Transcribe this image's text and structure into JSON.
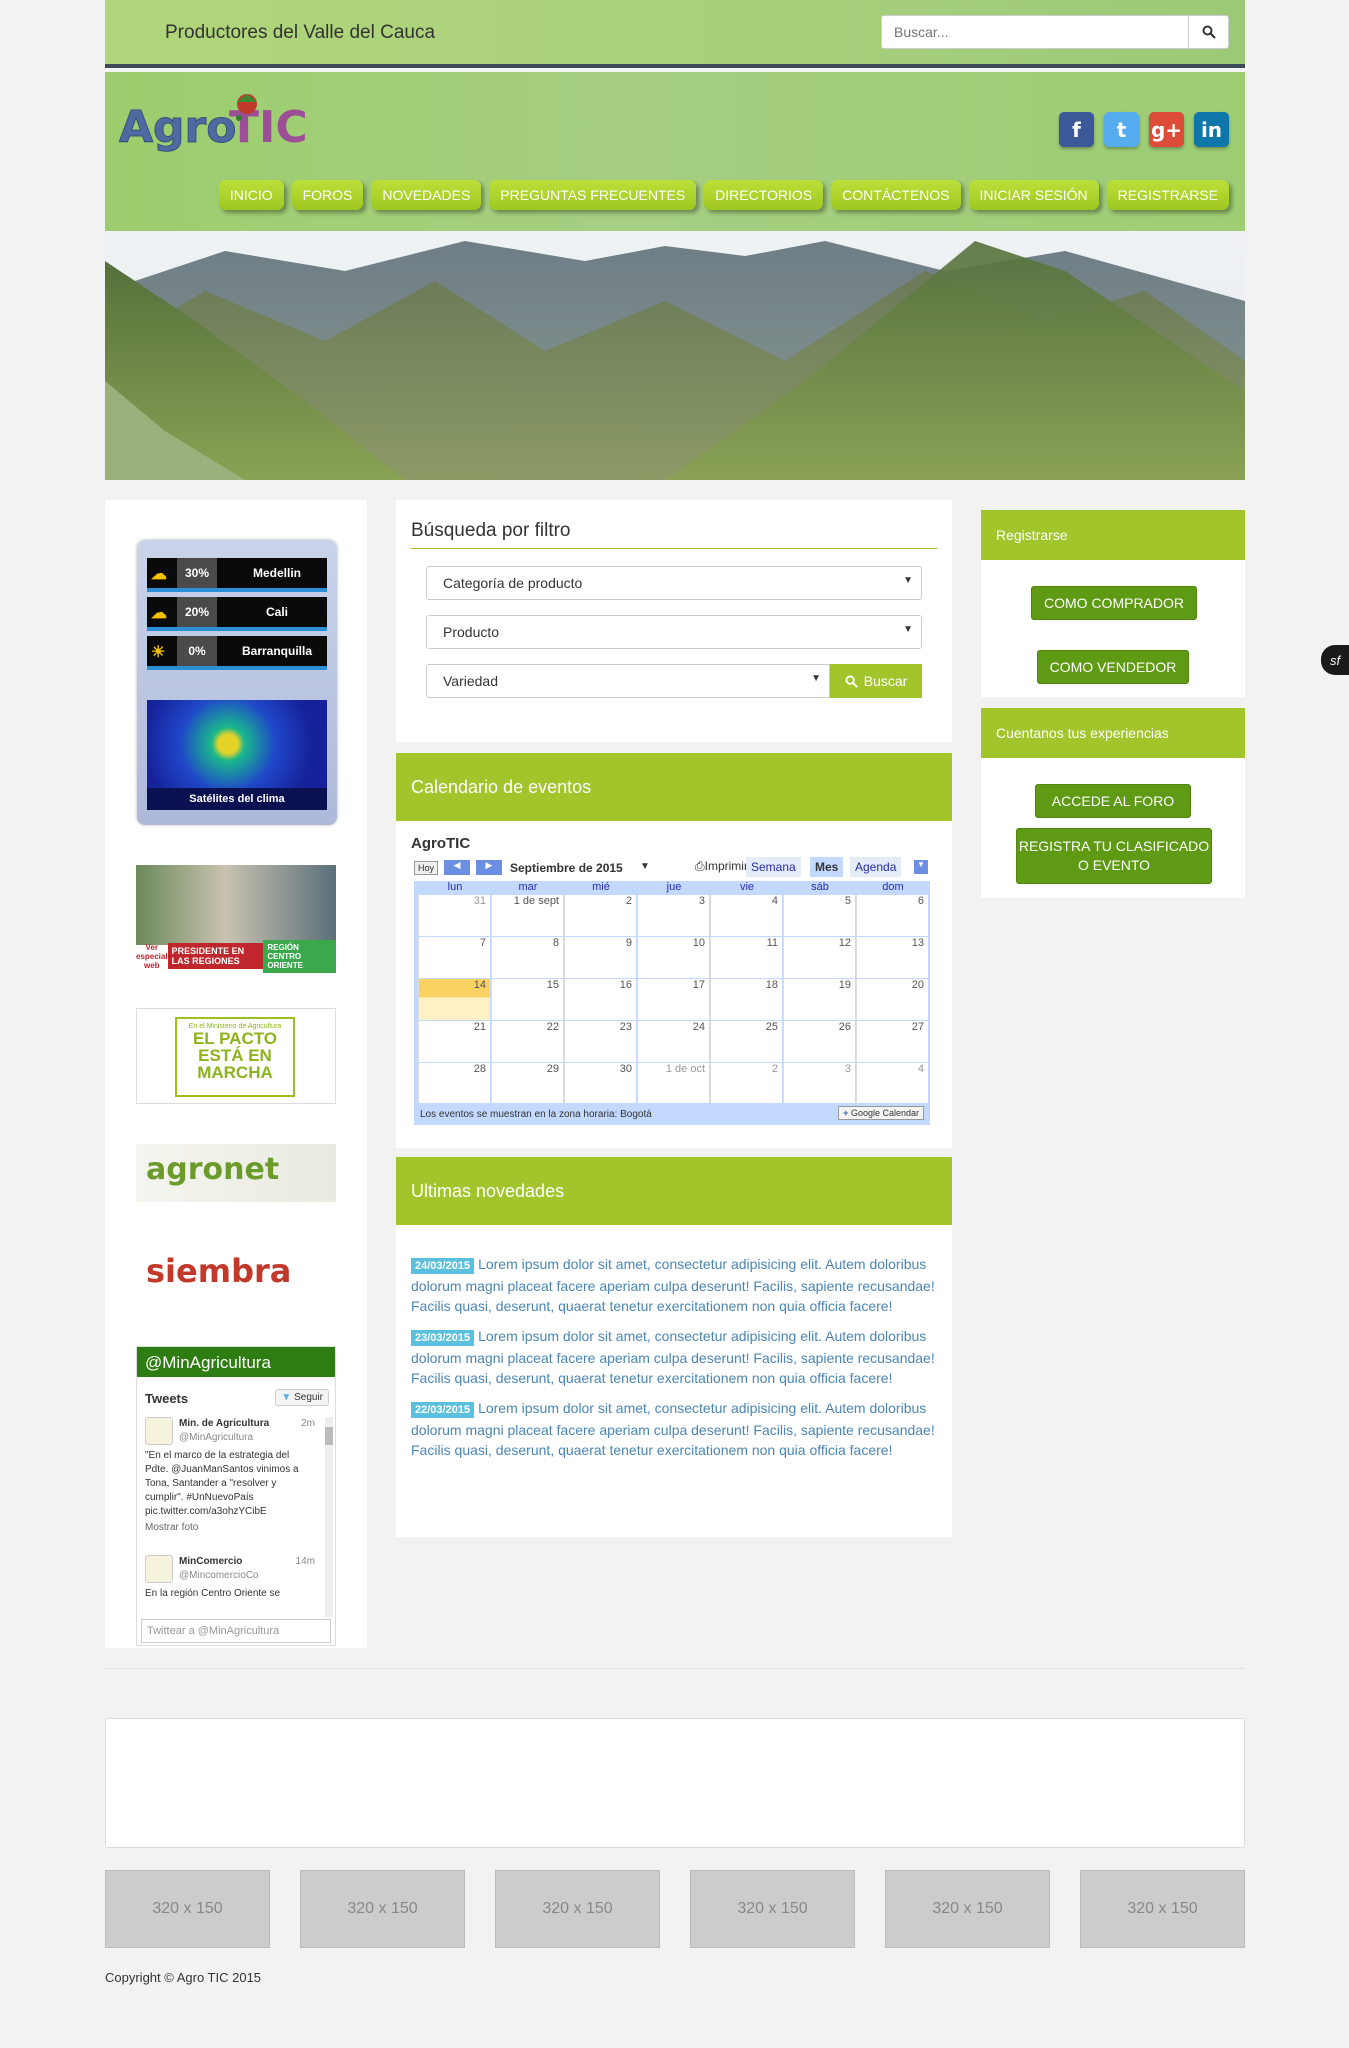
{
  "topbar": {
    "site_title": "Productores del Valle del Cauca",
    "search_placeholder": "Buscar..."
  },
  "header": {
    "logo_text": "AgroTIC",
    "social": [
      {
        "name": "facebook-icon",
        "glyph": "f",
        "color": "#3b5998"
      },
      {
        "name": "twitter-icon",
        "glyph": "t",
        "color": "#55acee"
      },
      {
        "name": "google-plus-icon",
        "glyph": "g+",
        "color": "#dd4b39"
      },
      {
        "name": "linkedin-icon",
        "glyph": "in",
        "color": "#0e76a8"
      }
    ],
    "nav": [
      "INICIO",
      "FOROS",
      "NOVEDADES",
      "PREGUNTAS FRECUENTES",
      "DIRECTORIOS",
      "CONTÁCTENOS",
      "INICIAR SESIÓN",
      "REGISTRARSE"
    ]
  },
  "sidebar": {
    "weather": [
      {
        "pct": "30%",
        "city": "Medellin"
      },
      {
        "pct": "20%",
        "city": "Cali"
      },
      {
        "pct": "0%",
        "city": "Barranquilla"
      }
    ],
    "satellite_label": "Satélites del clima",
    "promo1": {
      "special": "Ver especial web",
      "title": "PRESIDENTE EN LAS REGIONES",
      "region": "REGIÓN CENTRO ORIENTE"
    },
    "promo2": {
      "line1": "En el Ministerio de Agricultura",
      "line2": "EL PACTO",
      "line3": "ESTÁ EN",
      "line4": "MARCHA"
    },
    "agronet": "agronet",
    "siembra": "siembra",
    "twitter": {
      "handle": "@MinAgricultura",
      "tweets_label": "Tweets",
      "follow_label": "Seguir",
      "tweet1": {
        "name": "Min. de Agricultura",
        "user": "@MinAgricultura",
        "time": "2m",
        "text": "\"En el marco de la estrategia del Pdte. @JuanManSantos vinimos a Tona, Santander a \"resolver y cumplir\". #UnNuevoPaís pic.twitter.com/a3ohzYCibE",
        "media": "Mostrar foto"
      },
      "tweet2": {
        "name": "MinComercio",
        "user": "@MincomercioCo",
        "time": "14m",
        "text": "En la región Centro Oriente se"
      },
      "compose_placeholder": "Twittear a @MinAgricultura"
    }
  },
  "filter": {
    "title": "Búsqueda por filtro",
    "category": "Categoría de producto",
    "product": "Producto",
    "variety": "Variedad",
    "search_button": "Buscar"
  },
  "calendar": {
    "section_title": "Calendario de eventos",
    "cal_title": "AgroTIC",
    "today": "Hoy",
    "month": "Septiembre de 2015",
    "print": "Imprimir",
    "week": "Semana",
    "month_tab": "Mes",
    "agenda": "Agenda",
    "days": [
      "lun",
      "mar",
      "mié",
      "jue",
      "vie",
      "sáb",
      "dom"
    ],
    "weeks": [
      [
        "31",
        "1 de sept",
        "2",
        "3",
        "4",
        "5",
        "6"
      ],
      [
        "7",
        "8",
        "9",
        "10",
        "11",
        "12",
        "13"
      ],
      [
        "14",
        "15",
        "16",
        "17",
        "18",
        "19",
        "20"
      ],
      [
        "21",
        "22",
        "23",
        "24",
        "25",
        "26",
        "27"
      ],
      [
        "28",
        "29",
        "30",
        "1 de oct",
        "2",
        "3",
        "4"
      ]
    ],
    "timezone_note": "Los eventos se muestran en la zona horaria: Bogotá",
    "gcal_badge": "Google Calendar"
  },
  "news": {
    "section_title": "Ultimas novedades",
    "items": [
      {
        "date": "24/03/2015",
        "text": "Lorem ipsum dolor sit amet, consectetur adipisicing elit. Autem doloribus dolorum magni placeat facere aperiam culpa deserunt! Facilis, sapiente recusandae! Facilis quasi, deserunt, quaerat tenetur exercitationem non quia officia facere!"
      },
      {
        "date": "23/03/2015",
        "text": "Lorem ipsum dolor sit amet, consectetur adipisicing elit. Autem doloribus dolorum magni placeat facere aperiam culpa deserunt! Facilis, sapiente recusandae! Facilis quasi, deserunt, quaerat tenetur exercitationem non quia officia facere!"
      },
      {
        "date": "22/03/2015",
        "text": "Lorem ipsum dolor sit amet, consectetur adipisicing elit. Autem doloribus dolorum magni placeat facere aperiam culpa deserunt! Facilis, sapiente recusandae! Facilis quasi, deserunt, quaerat tenetur exercitationem non quia officia facere!"
      }
    ]
  },
  "register": {
    "title": "Registrarse",
    "buyer": "COMO COMPRADOR",
    "seller": "COMO VENDEDOR"
  },
  "experiences": {
    "title": "Cuentanos tus experiencias",
    "forum": "ACCEDE AL FORO",
    "classified": "REGISTRA TU CLASIFICADO O EVENTO"
  },
  "thumbnails": [
    "320 x 150",
    "320 x 150",
    "320 x 150",
    "320 x 150",
    "320 x 150",
    "320 x 150"
  ],
  "footer": {
    "copyright": "Copyright © Agro TIC 2015"
  },
  "floating": {
    "glyph": "sf"
  }
}
